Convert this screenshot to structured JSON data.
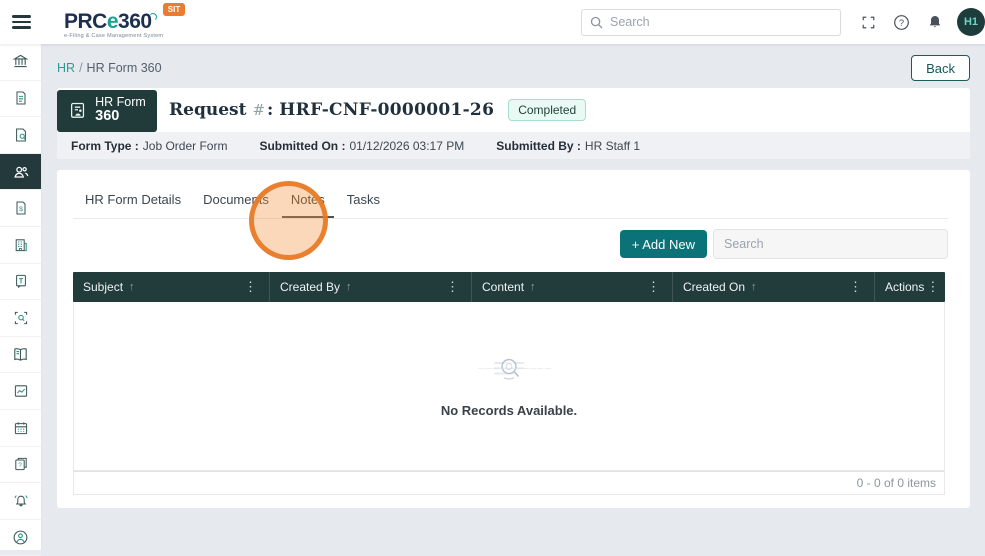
{
  "header": {
    "logo": {
      "part_prc": "PRC",
      "part_e": "e",
      "part_36": "36",
      "part_0": "0",
      "tagline": "e-Filing & Case Management System",
      "env_badge": "SIT"
    },
    "search_placeholder": "Search",
    "icons": [
      "menu-icon",
      "search-icon",
      "fullscreen-icon",
      "help-icon",
      "bell-icon"
    ],
    "avatar_initials": "H1"
  },
  "sidebar": {
    "active_index": 3,
    "icons": [
      "bank-icon",
      "file-text-icon",
      "file-search-icon",
      "users-icon",
      "file-dollar-icon",
      "building-icon",
      "file-t-icon",
      "scan-search-icon",
      "book-icon",
      "chart-icon",
      "calendar-icon",
      "file-question-icon",
      "bell-ring-icon",
      "user-circle-icon"
    ]
  },
  "breadcrumb": {
    "section": "HR",
    "separator": "/",
    "page": "HR Form 360"
  },
  "back_button": "Back",
  "form_card": {
    "badge_line1": "HR Form",
    "badge_line2": "360",
    "request_label": "Request",
    "request_hash": "#",
    "request_colon": ":",
    "request_number": "HRF-CNF-0000001-26",
    "status": "Completed",
    "meta": [
      {
        "label": "Form Type :",
        "value": "Job Order Form"
      },
      {
        "label": "Submitted On :",
        "value": "01/12/2026 03:17 PM"
      },
      {
        "label": "Submitted By :",
        "value": "HR Staff 1"
      }
    ]
  },
  "tabs": [
    {
      "label": "HR Form Details",
      "active": false
    },
    {
      "label": "Documents",
      "active": false
    },
    {
      "label": "Notes",
      "active": true
    },
    {
      "label": "Tasks",
      "active": false
    }
  ],
  "toolbar": {
    "add_new": "+ Add New",
    "search_placeholder": "Search"
  },
  "table": {
    "sort_icon": "↑",
    "menu_icon": "⋮",
    "columns": [
      {
        "label": "Subject",
        "sortable": true
      },
      {
        "label": "Created By",
        "sortable": true
      },
      {
        "label": "Content",
        "sortable": true
      },
      {
        "label": "Created On",
        "sortable": true
      },
      {
        "label": "Actions",
        "sortable": false
      }
    ],
    "rows": [],
    "empty_text": "No Records Available.",
    "pager_text": "0 - 0 of 0 items"
  },
  "colors": {
    "dark_teal": "#213c3b",
    "accent_teal": "#0b7377",
    "link_teal": "#2d9b94",
    "logo_navy": "#1d2f4f",
    "logo_green": "#18a38e",
    "status_bg": "#e9f9f3",
    "status_border": "#a8dcd1",
    "env_orange": "#ec7b2d",
    "click_ring_orange": "#e77825",
    "page_bg": "#e6e9ee"
  }
}
